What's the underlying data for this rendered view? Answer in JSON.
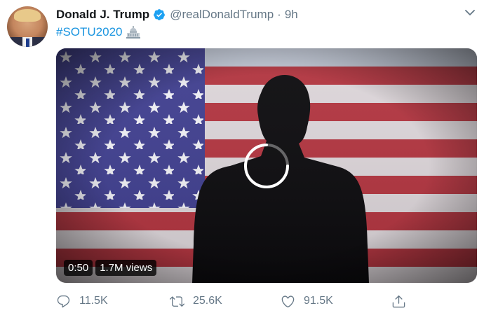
{
  "tweet": {
    "author_name": "Donald J. Trump",
    "handle": "@realDonaldTrump",
    "separator": "·",
    "time": "9h",
    "hashtag": "#SOTU2020",
    "verified": true,
    "accent_color": "#1b95e0"
  },
  "video": {
    "duration": "0:50",
    "views": "1.7M views",
    "state": "loading"
  },
  "actions": {
    "reply_count": "11.5K",
    "retweet_count": "25.6K",
    "like_count": "91.5K"
  },
  "icons": [
    "verified-badge-icon",
    "chevron-down-icon",
    "capitol-icon",
    "loading-spinner-icon",
    "reply-icon",
    "retweet-icon",
    "like-icon",
    "share-icon"
  ]
}
